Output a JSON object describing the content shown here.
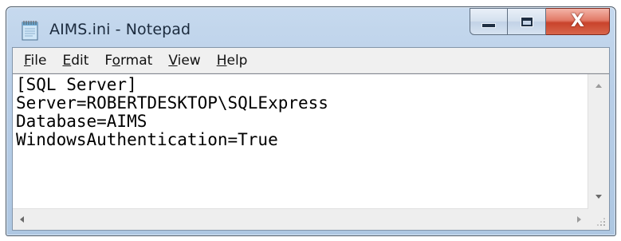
{
  "window": {
    "title": "AIMS.ini - Notepad",
    "app_icon": "notepad-icon"
  },
  "caption_buttons": {
    "minimize_icon": "minimize-icon",
    "maximize_icon": "maximize-icon",
    "close_icon": "close-icon",
    "close_glyph": "X"
  },
  "menu": {
    "items": [
      {
        "pre": "",
        "key": "F",
        "post": "ile"
      },
      {
        "pre": "",
        "key": "E",
        "post": "dit"
      },
      {
        "pre": "F",
        "key": "o",
        "post": "rmat"
      },
      {
        "pre": "",
        "key": "V",
        "post": "iew"
      },
      {
        "pre": "",
        "key": "H",
        "post": "elp"
      }
    ]
  },
  "document": {
    "lines": [
      "[SQL Server]",
      "Server=ROBERTDESKTOP\\SQLExpress",
      "Database=AIMS",
      "WindowsAuthentication=True"
    ]
  },
  "colors": {
    "title_bar": "#b9cfe8",
    "close_button": "#c9432c",
    "menu_bar": "#f0f0f0"
  }
}
